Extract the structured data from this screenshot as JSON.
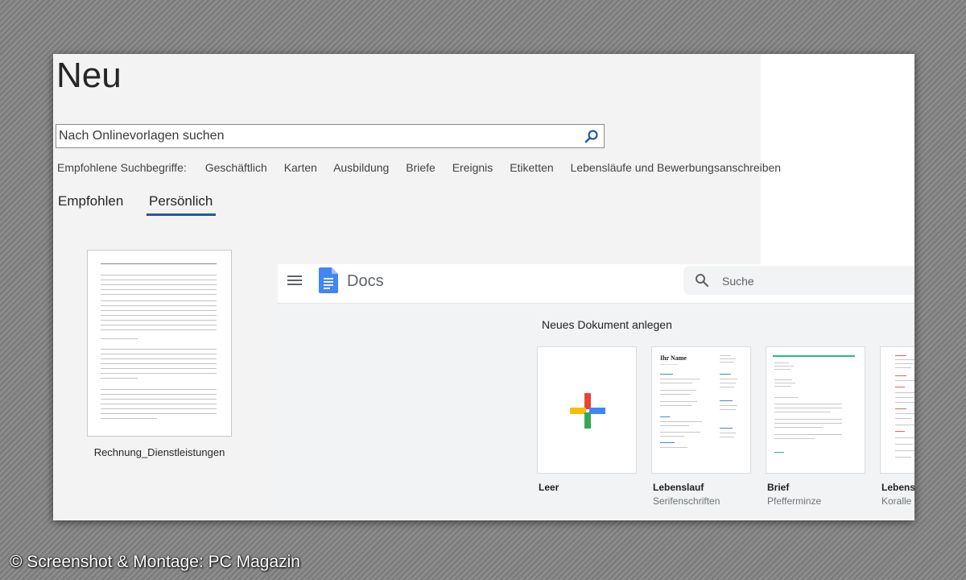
{
  "word": {
    "title": "Neu",
    "search": {
      "placeholder": "Nach Onlinevorlagen suchen",
      "value": ""
    },
    "suggested": {
      "label": "Empfohlene Suchbegriffe:",
      "terms": [
        "Geschäftlich",
        "Karten",
        "Ausbildung",
        "Briefe",
        "Ereignis",
        "Etiketten",
        "Lebensläufe und Bewerbungsanschreiben"
      ]
    },
    "tabs": [
      {
        "label": "Empfohlen",
        "active": false
      },
      {
        "label": "Persönlich",
        "active": true
      }
    ],
    "template": {
      "name": "Rechnung_Dienstleistungen"
    },
    "accent_color": "#2b579a"
  },
  "gdocs": {
    "app_name": "Docs",
    "search_placeholder": "Suche",
    "section_title": "Neues Dokument anlegen",
    "templates": [
      {
        "name": "Leer",
        "subtitle": ""
      },
      {
        "name": "Lebenslauf",
        "subtitle": "Serifenschriften",
        "preview_heading": "Ihr Name"
      },
      {
        "name": "Brief",
        "subtitle": "Pfefferminze"
      },
      {
        "name": "Lebens",
        "subtitle": "Koralle"
      }
    ],
    "plus_colors": [
      "#ea4335",
      "#fbbc04",
      "#34a853",
      "#4285f4"
    ]
  },
  "credit": "© Screenshot & Montage: PC Magazin"
}
